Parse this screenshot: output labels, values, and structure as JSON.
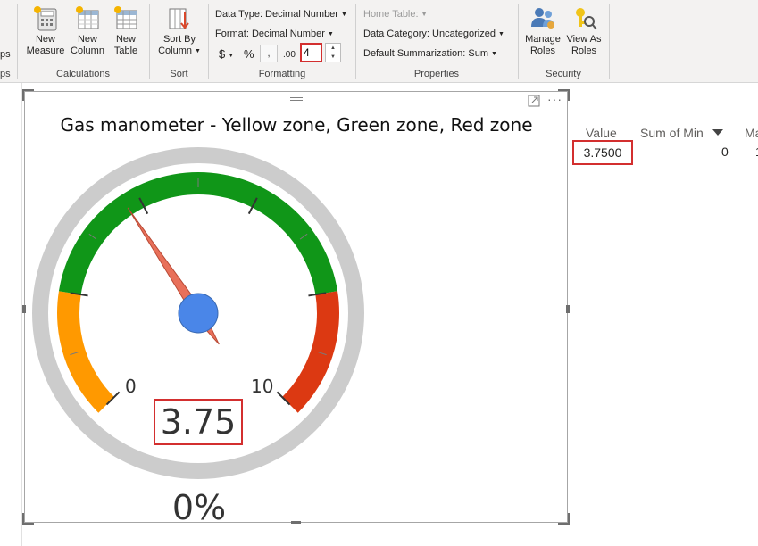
{
  "ribbon": {
    "groups": {
      "partial_label": "ps",
      "calculations": "Calculations",
      "sort": "Sort",
      "formatting": "Formatting",
      "properties": "Properties",
      "security": "Security"
    },
    "partial_top": "ps",
    "buttons": {
      "new_measure": [
        "New",
        "Measure"
      ],
      "new_column": [
        "New",
        "Column"
      ],
      "new_table": [
        "New",
        "Table"
      ],
      "sort_by_column": [
        "Sort By",
        "Column"
      ],
      "manage_roles": [
        "Manage",
        "Roles"
      ],
      "view_as_roles": [
        "View As",
        "Roles"
      ]
    },
    "formatting": {
      "data_type": "Data Type: Decimal Number",
      "format": "Format: Decimal Number",
      "currency_symbol": "$",
      "percent_symbol": "%",
      "comma_symbol": ",",
      "decimal_symbol": ".00",
      "decimal_places": "4"
    },
    "properties": {
      "home_table": "Home Table:",
      "data_category": "Data Category: Uncategorized",
      "default_summarization": "Default Summarization: Sum"
    }
  },
  "visual": {
    "title": "Gas manometer - Yellow zone, Green zone, Red zone",
    "value_display": "3.75",
    "percent_display": "0%",
    "scale_min_label": "0",
    "scale_max_label": "10",
    "gauge": {
      "min": 0,
      "max": 10,
      "value": 3.75,
      "zones": [
        {
          "name": "Yellow zone",
          "from": 0,
          "to": 2,
          "color": "#ff9900"
        },
        {
          "name": "Green zone",
          "from": 2,
          "to": 8,
          "color": "#109618"
        },
        {
          "name": "Red zone",
          "from": 8,
          "to": 10,
          "color": "#dc3912"
        }
      ],
      "needle_color": "#e8705a",
      "hub_color": "#4a86e8"
    }
  },
  "table": {
    "headers": [
      "Value",
      "Sum of Min",
      "Ma"
    ],
    "row": [
      "3.7500",
      "0",
      "1"
    ]
  },
  "colors": {
    "highlight": "#d32f2f",
    "ribbon_bg": "#f3f2f1"
  }
}
